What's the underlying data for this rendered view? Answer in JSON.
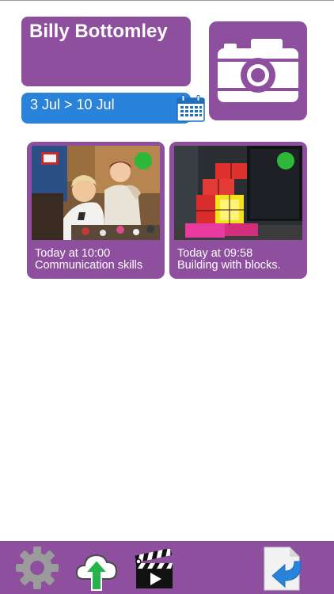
{
  "profile": {
    "name": "Billy Bottomley"
  },
  "date_range": {
    "label": "3 Jul > 10 Jul",
    "icon": "calendar-icon"
  },
  "camera": {
    "icon": "camera-icon"
  },
  "entries": [
    {
      "time": "Today at 10:00",
      "caption": "Communication skills",
      "status_color": "#2db83a",
      "photo": "children-at-table-photo"
    },
    {
      "time": "Today at 09:58",
      "caption": "Building with blocks.",
      "status_color": "#2db83a",
      "photo": "light-blocks-photo"
    }
  ],
  "toolbar": {
    "settings_icon": "gear-icon",
    "upload_icon": "cloud-upload-icon",
    "video_icon": "clapperboard-icon",
    "back_icon": "return-document-icon"
  },
  "colors": {
    "accent": "#8e4f9e",
    "date_bar": "#2a83db",
    "status": "#2db83a"
  }
}
